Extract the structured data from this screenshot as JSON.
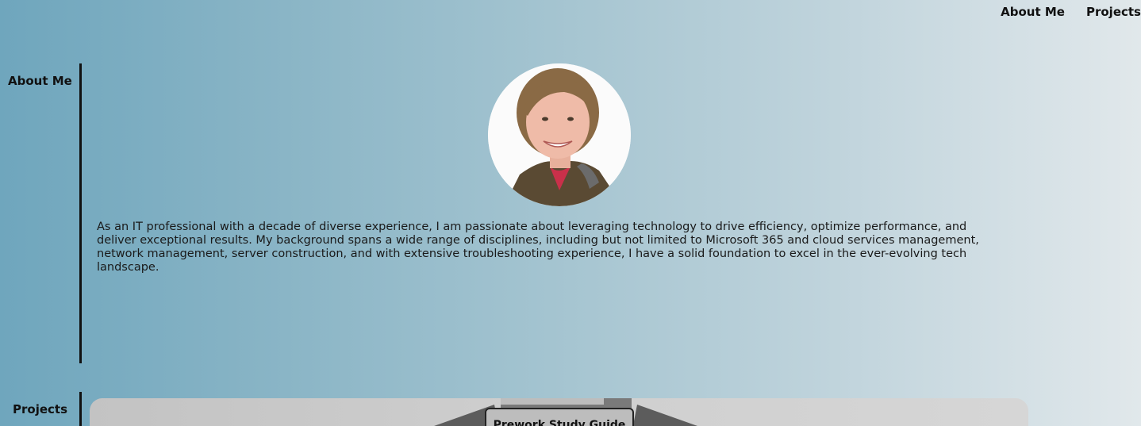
{
  "nav": {
    "about_label": "About Me",
    "projects_label": "Projects"
  },
  "about": {
    "section_label": "About Me",
    "bio": "As an IT professional with a decade of diverse experience, I am passionate about leveraging technology to drive efficiency, optimize performance, and deliver exceptional results. My background spans a wide range of disciplines, including but not limited to Microsoft 365 and cloud services management, network management, server construction, and with extensive troubleshooting experience, I have a solid foundation to excel in the ever-evolving tech landscape."
  },
  "projects": {
    "section_label": "Projects",
    "items": [
      {
        "title": "Prework Study Guide"
      }
    ]
  },
  "colors": {
    "gradient_start": "#6fa6bd",
    "gradient_end": "#e1e8eb",
    "text": "#111111",
    "card": "#cfcfcf"
  }
}
